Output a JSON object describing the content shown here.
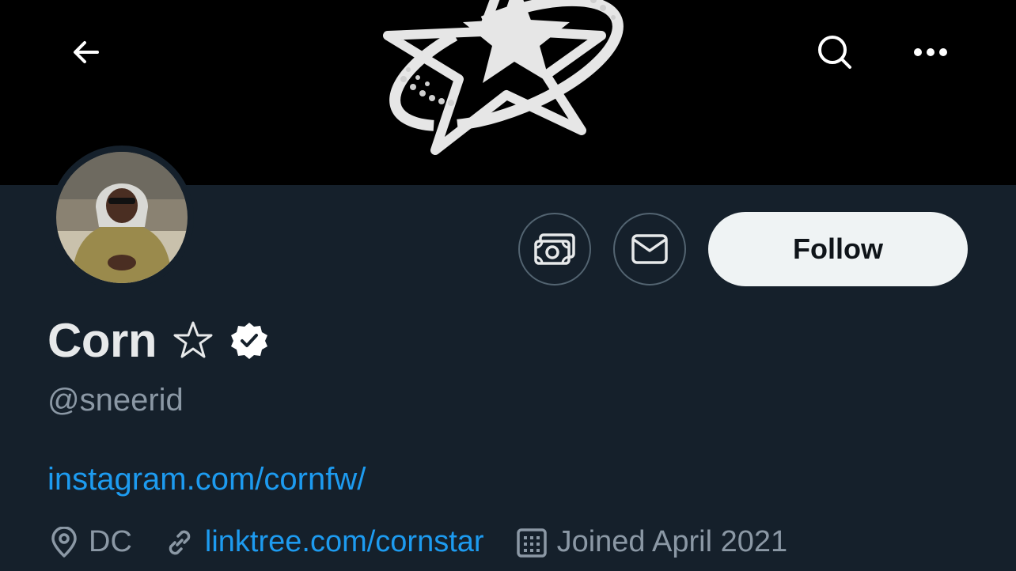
{
  "header": {
    "back_icon": "arrow-left-icon",
    "search_icon": "search-icon",
    "more_icon": "more-dots-icon"
  },
  "profile": {
    "display_name": "Corn",
    "name_emoji_icon": "star-outline-icon",
    "verified_icon": "verified-badge-icon",
    "handle": "@sneerid",
    "bio_link": "instagram.com/cornfw/",
    "location": "DC",
    "website": "linktree.com/cornstar",
    "joined": "Joined April 2021"
  },
  "actions": {
    "tip_icon": "money-icon",
    "message_icon": "mail-icon",
    "follow_label": "Follow"
  },
  "colors": {
    "background": "#15202b",
    "banner": "#000000",
    "accent_link": "#1d9bf0",
    "secondary_text": "#8b98a5",
    "primary_text": "#e7e9ea",
    "follow_bg": "#eff3f4"
  }
}
